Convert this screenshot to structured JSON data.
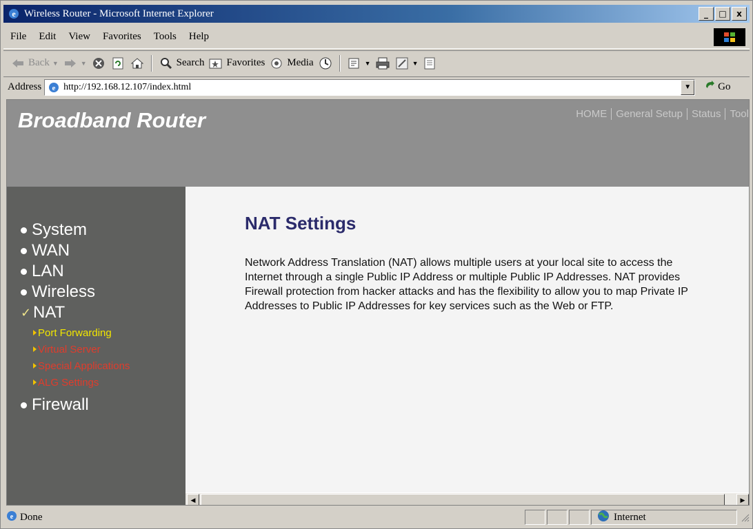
{
  "window": {
    "title": "Wireless Router - Microsoft Internet Explorer",
    "minimize": "_",
    "maximize": "□",
    "close": "x"
  },
  "menubar": {
    "items": [
      {
        "label": "File"
      },
      {
        "label": "Edit"
      },
      {
        "label": "View"
      },
      {
        "label": "Favorites"
      },
      {
        "label": "Tools"
      },
      {
        "label": "Help"
      }
    ]
  },
  "toolbar": {
    "back": "Back",
    "search": "Search",
    "favorites": "Favorites",
    "media": "Media"
  },
  "addressbar": {
    "label": "Address",
    "url": "http://192.168.12.107/index.html",
    "go": "Go"
  },
  "page": {
    "brand": "Broadband Router",
    "topnav": [
      {
        "label": "HOME"
      },
      {
        "label": "General Setup"
      },
      {
        "label": "Status"
      },
      {
        "label": "Tool"
      }
    ],
    "sidebar": {
      "items": [
        {
          "label": "System"
        },
        {
          "label": "WAN"
        },
        {
          "label": "LAN"
        },
        {
          "label": "Wireless"
        },
        {
          "label": "NAT"
        }
      ],
      "nat_subitems": [
        {
          "label": "Port Forwarding"
        },
        {
          "label": "Virtual Server"
        },
        {
          "label": "Special Applications"
        },
        {
          "label": "ALG Settings"
        }
      ],
      "firewall": "Firewall"
    },
    "title": "NAT Settings",
    "description": "Network Address Translation (NAT) allows multiple users at your local site to access the Internet through a single Public IP Address or multiple Public IP Addresses. NAT provides Firewall protection from hacker attacks and has the flexibility to allow you to map Private IP Addresses to Public IP Addresses for key services such as the Web or FTP."
  },
  "statusbar": {
    "status": "Done",
    "zone": "Internet"
  },
  "colors": {
    "banner": "#8f8f8f",
    "sidebar": "#5f605e",
    "title": "#2b2b6b",
    "active_sub": "#f2e600",
    "inactive_sub": "#e03c2c"
  }
}
